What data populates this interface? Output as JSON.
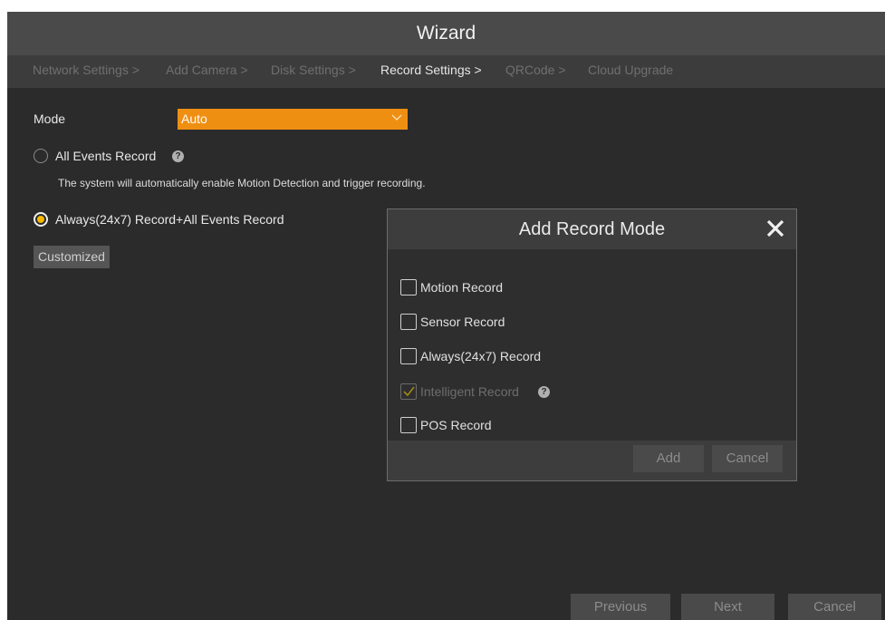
{
  "title": "Wizard",
  "steps": [
    {
      "label": "Network Settings >",
      "active": false
    },
    {
      "label": "Add Camera >",
      "active": false
    },
    {
      "label": "Disk Settings >",
      "active": false
    },
    {
      "label": "Record Settings >",
      "active": true
    },
    {
      "label": "QRCode >",
      "active": false
    },
    {
      "label": "Cloud Upgrade",
      "active": false
    }
  ],
  "mode": {
    "label": "Mode",
    "value": "Auto",
    "icon": "chevron-down-icon"
  },
  "options": {
    "all_events": {
      "label": "All Events Record",
      "selected": false,
      "help_icon": "?"
    },
    "description": "The system will automatically enable Motion Detection and trigger recording.",
    "always_all": {
      "label": "Always(24x7) Record+All Events Record",
      "selected": true
    }
  },
  "customized_label": "Customized",
  "dialog": {
    "title": "Add Record Mode",
    "close_icon": "close-icon",
    "items": [
      {
        "label": "Motion Record",
        "checked": false,
        "disabled": false
      },
      {
        "label": "Sensor Record",
        "checked": false,
        "disabled": false
      },
      {
        "label": "Always(24x7) Record",
        "checked": false,
        "disabled": false
      },
      {
        "label": "Intelligent Record",
        "checked": true,
        "disabled": true,
        "help_icon": "?"
      },
      {
        "label": "POS Record",
        "checked": false,
        "disabled": false
      }
    ],
    "add_label": "Add",
    "cancel_label": "Cancel"
  },
  "footer": {
    "previous": "Previous",
    "next": "Next",
    "cancel": "Cancel"
  },
  "colors": {
    "accent": "#ef8f12",
    "radio_dot": "#f5b800",
    "background": "#2b2b2b"
  }
}
